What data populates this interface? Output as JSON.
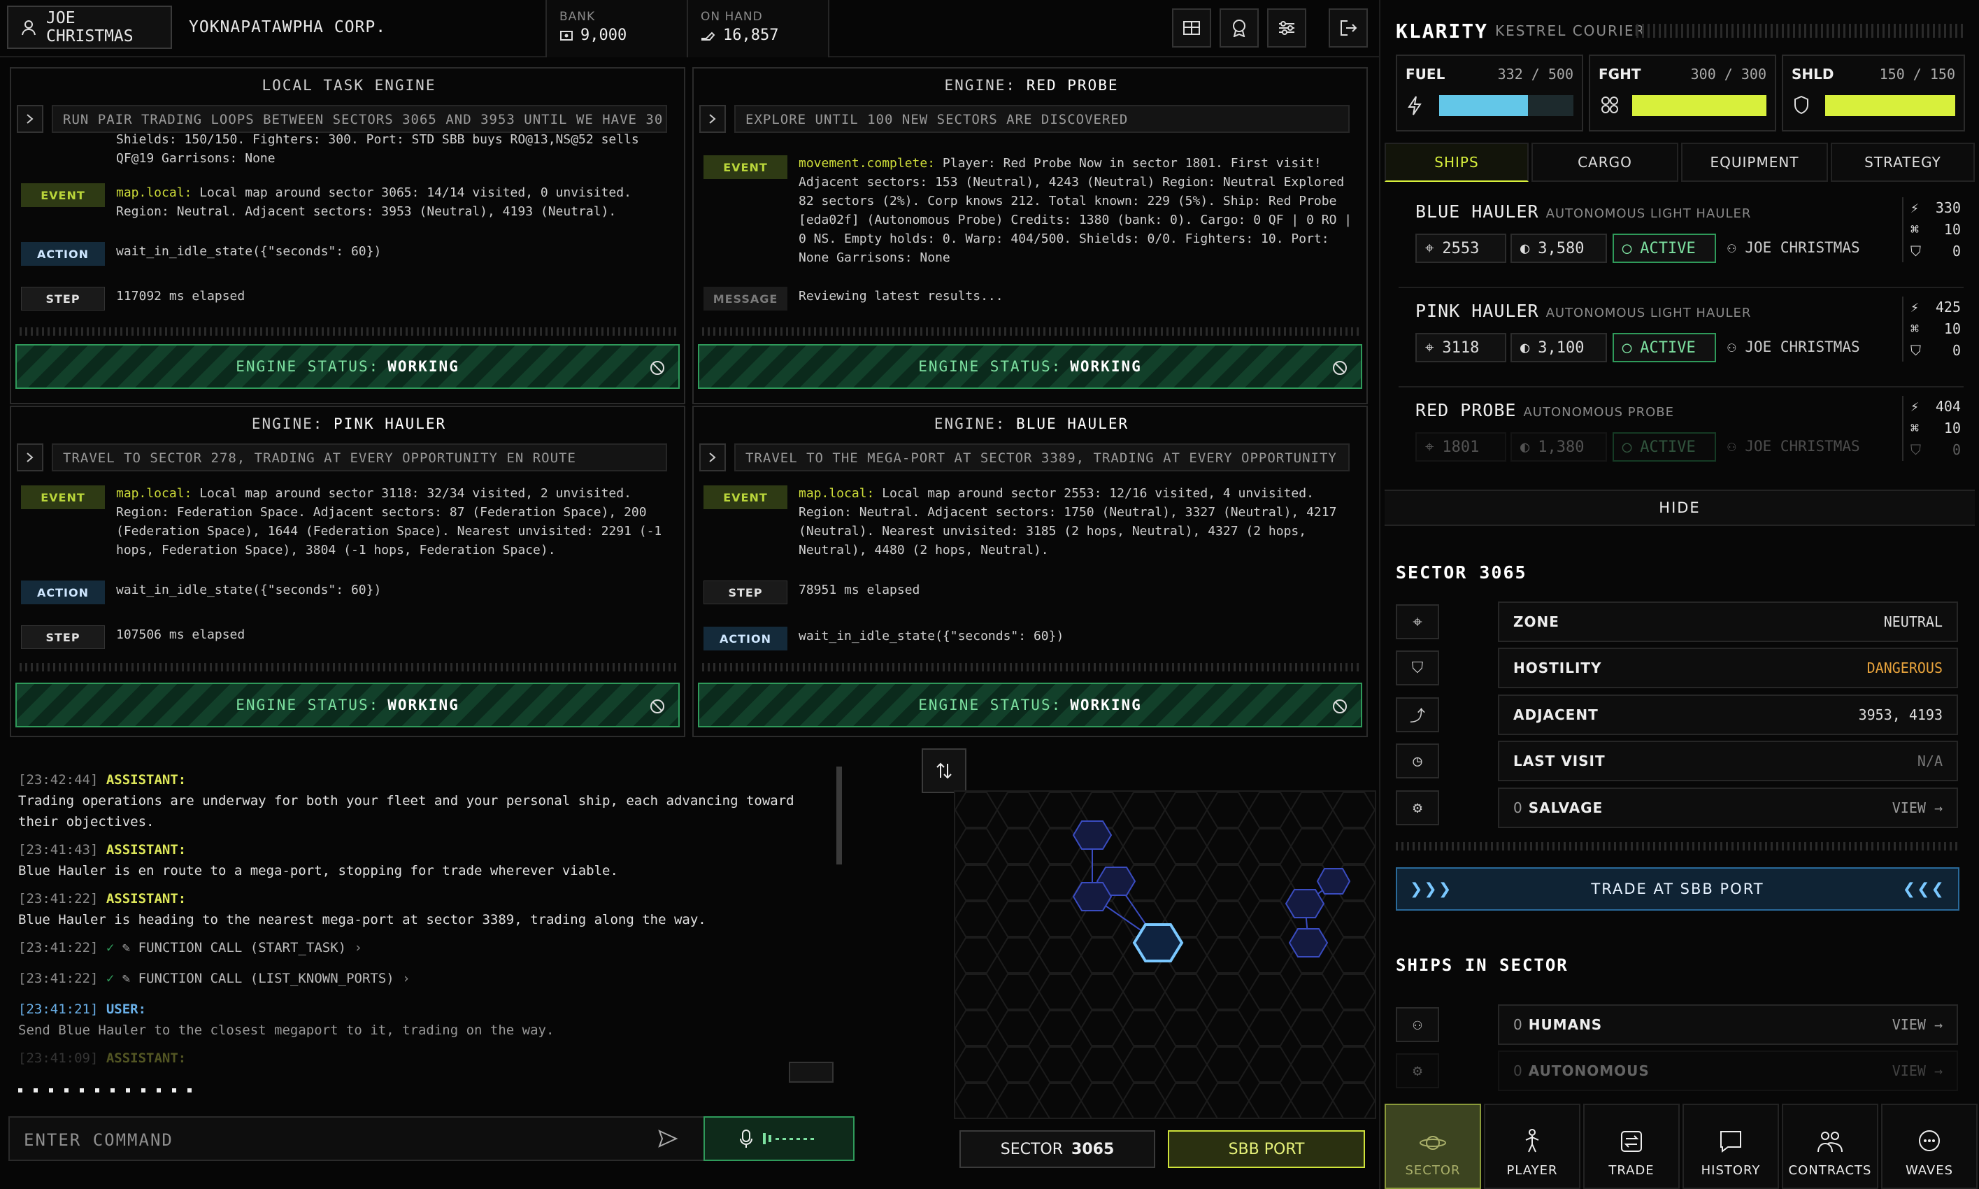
{
  "header": {
    "user": "JOE CHRISTMAS",
    "corp": "YOKNAPATAWPHA CORP.",
    "bank_label": "BANK",
    "bank_value": "9,000",
    "onhand_label": "ON HAND",
    "onhand_value": "16,857"
  },
  "engines": [
    {
      "title_prefix": "",
      "title": "LOCAL TASK ENGINE",
      "task": "RUN PAIR TRADING LOOPS BETWEEN SECTORS 3065 AND 3953 UNTIL WE HAVE 30...",
      "overflow": "Shields: 150/150. Fighters: 300. Port: STD SBB buys RO@13,NS@52 sells\nQF@19 Garrisons: None",
      "logs": [
        {
          "badge": "EVENT",
          "key": "map.local:",
          "text": " Local map around sector 3065: 14/14 visited, 0 unvisited.\nRegion: Neutral. Adjacent sectors: 3953 (Neutral), 4193 (Neutral)."
        },
        {
          "badge": "ACTION",
          "key": "",
          "text": "wait_in_idle_state({\"seconds\": 60})"
        },
        {
          "badge": "STEP",
          "key": "",
          "text": "117092 ms elapsed"
        }
      ],
      "status_label": "ENGINE STATUS:",
      "status_value": "WORKING"
    },
    {
      "title_prefix": "ENGINE:",
      "title": "RED PROBE",
      "task": "EXPLORE UNTIL 100 NEW SECTORS ARE DISCOVERED",
      "overflow": "Region: Neutral.",
      "logs": [
        {
          "badge": "EVENT",
          "key": "movement.complete:",
          "text": " Player: Red Probe Now in sector 1801. First visit!\nAdjacent sectors: 153 (Neutral), 4243 (Neutral) Region: Neutral Explored\n82 sectors (2%). Corp knows 212. Total known: 229 (5%). Ship: Red Probe\n[eda02f] (Autonomous Probe) Credits: 1380 (bank: 0). Cargo: 0 QF | 0 RO |\n0 NS. Empty holds: 0. Warp: 404/500. Shields: 0/0. Fighters: 10. Port:\nNone Garrisons: None"
        },
        {
          "badge": "MESSAGE",
          "key": "",
          "text": "Reviewing latest results..."
        }
      ],
      "status_label": "ENGINE STATUS:",
      "status_value": "WORKING"
    },
    {
      "title_prefix": "ENGINE:",
      "title": "PINK HAULER",
      "task": "TRAVEL TO SECTOR 278, TRADING AT EVERY OPPORTUNITY EN ROUTE",
      "overflow": "",
      "logs": [
        {
          "badge": "EVENT",
          "key": "map.local:",
          "text": " Local map around sector 3118: 32/34 visited, 2 unvisited.\nRegion: Federation Space. Adjacent sectors: 87 (Federation Space), 200\n(Federation Space), 1644 (Federation Space). Nearest unvisited: 2291 (-1\nhops, Federation Space), 3804 (-1 hops, Federation Space)."
        },
        {
          "badge": "ACTION",
          "key": "",
          "text": "wait_in_idle_state({\"seconds\": 60})"
        },
        {
          "badge": "STEP",
          "key": "",
          "text": "107506 ms elapsed"
        }
      ],
      "status_label": "ENGINE STATUS:",
      "status_value": "WORKING"
    },
    {
      "title_prefix": "ENGINE:",
      "title": "BLUE HAULER",
      "task": "TRAVEL TO THE MEGA-PORT AT SECTOR 3389, TRADING AT EVERY OPPORTUNITY",
      "overflow": "",
      "logs": [
        {
          "badge": "EVENT",
          "key": "map.local:",
          "text": " Local map around sector 2553: 12/16 visited, 4 unvisited.\nRegion: Neutral. Adjacent sectors: 1750 (Neutral), 3327 (Neutral), 4217\n(Neutral). Nearest unvisited: 3185 (2 hops, Neutral), 4327 (2 hops,\nNeutral), 4480 (2 hops, Neutral)."
        },
        {
          "badge": "STEP",
          "key": "",
          "text": "78951 ms elapsed"
        },
        {
          "badge": "ACTION",
          "key": "",
          "text": "wait_in_idle_state({\"seconds\": 60})"
        }
      ],
      "status_label": "ENGINE STATUS:",
      "status_value": "WORKING"
    }
  ],
  "chat": [
    {
      "time": "[23:42:44]",
      "who": "ASSISTANT:",
      "text": "Trading operations are underway for both your fleet and your personal ship, each advancing toward\ntheir objectives."
    },
    {
      "time": "[23:41:43]",
      "who": "ASSISTANT:",
      "text": "Blue Hauler is en route to a mega-port, stopping for trade wherever viable."
    },
    {
      "time": "[23:41:22]",
      "who": "ASSISTANT:",
      "text": "Blue Hauler is heading to the nearest mega-port at sector 3389, trading along the way."
    },
    {
      "time": "[23:41:22]",
      "fn": "FUNCTION CALL (START_TASK)"
    },
    {
      "time": "[23:41:22]",
      "fn": "FUNCTION CALL (LIST_KNOWN_PORTS)"
    },
    {
      "time": "[23:41:21]",
      "who": "USER:",
      "text": "Send Blue Hauler to the closest megaport to it, trading on the way."
    },
    {
      "time": "[23:41:09]",
      "who": "ASSISTANT:",
      "text": ""
    }
  ],
  "command": {
    "placeholder": "ENTER COMMAND"
  },
  "map": {
    "sector_label": "SECTOR",
    "sector_value": "3065",
    "port_label": "SBB PORT"
  },
  "ship_panel": {
    "name": "KLARITY",
    "class": "KESTREL COURIER",
    "meters": [
      {
        "label": "FUEL",
        "value": 332,
        "max": 500,
        "color": "#63c7e8"
      },
      {
        "label": "FGHT",
        "value": 300,
        "max": 300,
        "color": "#d8f03c"
      },
      {
        "label": "SHLD",
        "value": 150,
        "max": 150,
        "color": "#d8f03c"
      }
    ],
    "tabs": [
      "SHIPS",
      "CARGO",
      "EQUIPMENT",
      "STRATEGY"
    ],
    "ships": [
      {
        "name": "BLUE HAULER",
        "type": "AUTONOMOUS LIGHT HAULER",
        "sector": "2553",
        "credits": "3,580",
        "state": "ACTIVE",
        "owner": "JOE CHRISTMAS",
        "fuel": "330",
        "fighters": "10",
        "shields": "0"
      },
      {
        "name": "PINK HAULER",
        "type": "AUTONOMOUS LIGHT HAULER",
        "sector": "3118",
        "credits": "3,100",
        "state": "ACTIVE",
        "owner": "JOE CHRISTMAS",
        "fuel": "425",
        "fighters": "10",
        "shields": "0"
      },
      {
        "name": "RED PROBE",
        "type": "AUTONOMOUS PROBE",
        "sector": "1801",
        "credits": "1,380",
        "state": "ACTIVE",
        "owner": "JOE CHRISTMAS",
        "fuel": "404",
        "fighters": "10",
        "shields": "0"
      }
    ],
    "hide_label": "HIDE"
  },
  "sector": {
    "title": "SECTOR 3065",
    "rows": [
      {
        "label": "ZONE",
        "value": "NEUTRAL"
      },
      {
        "label": "HOSTILITY",
        "value": "DANGEROUS"
      },
      {
        "label": "ADJACENT",
        "value": "3953, 4193"
      },
      {
        "label": "LAST VISIT",
        "value": "N/A"
      },
      {
        "label": "SALVAGE",
        "count": "0",
        "value": "VIEW"
      }
    ],
    "trade_label": "TRADE AT SBB PORT",
    "ships_title": "SHIPS IN SECTOR",
    "ships_rows": [
      {
        "count": "0",
        "label": "HUMANS",
        "value": "VIEW"
      },
      {
        "count": "0",
        "label": "AUTONOMOUS",
        "value": "VIEW"
      }
    ]
  },
  "bottom_nav": [
    "SECTOR",
    "PLAYER",
    "TRADE",
    "HISTORY",
    "CONTRACTS",
    "WAVES"
  ],
  "colors": {
    "accent_green": "#2f9a5a",
    "accent_yellow": "#d8f03c",
    "danger": "#e6a23c",
    "fuel": "#63c7e8"
  }
}
